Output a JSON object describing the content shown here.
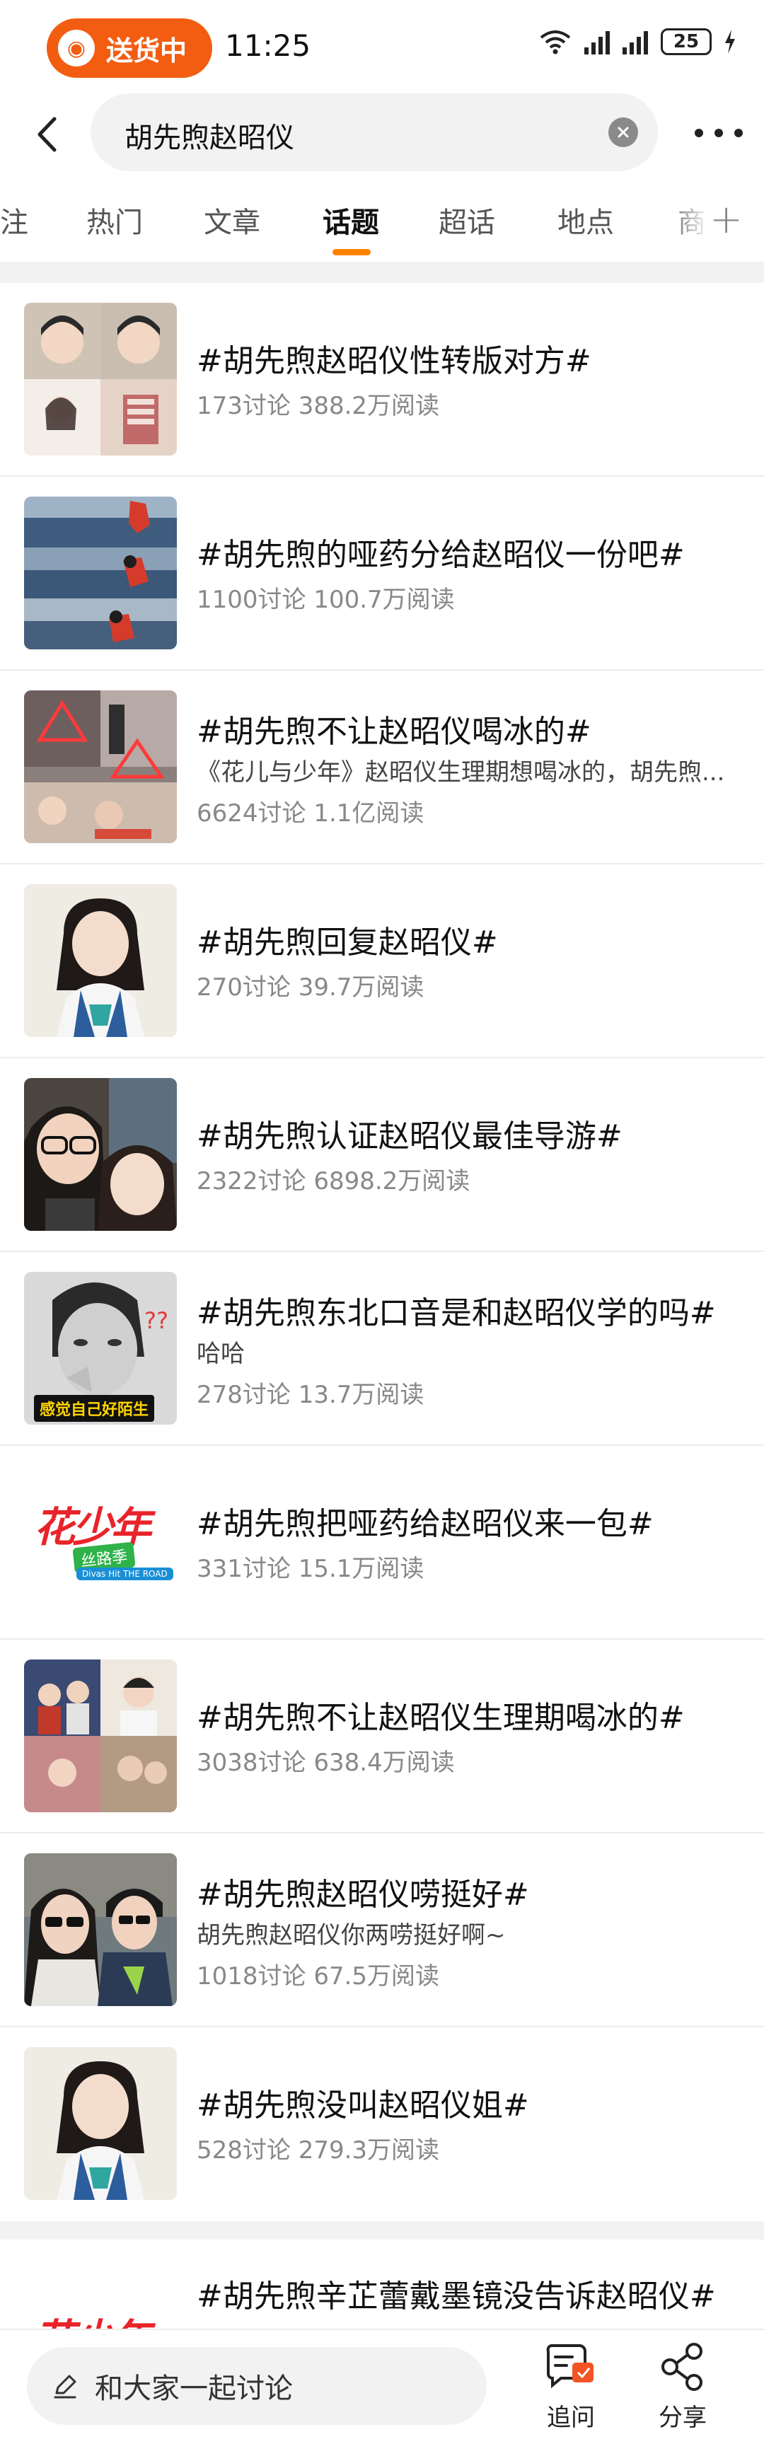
{
  "status_bar": {
    "delivery_label": "送货中",
    "time": "11:25",
    "battery": "25"
  },
  "search": {
    "query": "胡先煦赵昭仪"
  },
  "tabs": [
    {
      "label": "注"
    },
    {
      "label": "热门"
    },
    {
      "label": "文章"
    },
    {
      "label": "话题",
      "active": true
    },
    {
      "label": "超话"
    },
    {
      "label": "地点"
    },
    {
      "label": "商"
    }
  ],
  "topics": [
    {
      "title": "#胡先煦赵昭仪性转版对方#",
      "desc": "",
      "stats": "173讨论 388.2万阅读"
    },
    {
      "title": "#胡先煦的哑药分给赵昭仪一份吧#",
      "desc": "",
      "stats": "1100讨论 100.7万阅读"
    },
    {
      "title": "#胡先煦不让赵昭仪喝冰的#",
      "desc": "《花儿与少年》赵昭仪生理期想喝冰的，胡先煦...",
      "stats": "6624讨论 1.1亿阅读"
    },
    {
      "title": "#胡先煦回复赵昭仪#",
      "desc": "",
      "stats": "270讨论 39.7万阅读"
    },
    {
      "title": "#胡先煦认证赵昭仪最佳导游#",
      "desc": "",
      "stats": "2322讨论 6898.2万阅读"
    },
    {
      "title": "#胡先煦东北口音是和赵昭仪学的吗#",
      "desc": "哈哈",
      "stats": "278讨论 13.7万阅读"
    },
    {
      "title": "#胡先煦把哑药给赵昭仪来一包#",
      "desc": "",
      "stats": "331讨论 15.1万阅读"
    },
    {
      "title": "#胡先煦不让赵昭仪生理期喝冰的#",
      "desc": "",
      "stats": "3038讨论 638.4万阅读"
    },
    {
      "title": "#胡先煦赵昭仪唠挺好#",
      "desc": "胡先煦赵昭仪你两唠挺好啊~",
      "stats": "1018讨论 67.5万阅读"
    },
    {
      "title": "#胡先煦没叫赵昭仪姐#",
      "desc": "",
      "stats": "528讨论 279.3万阅读"
    },
    {
      "title": "#胡先煦辛芷蕾戴墨镜没告诉赵昭仪#",
      "desc": "",
      "stats": ""
    }
  ],
  "thumb_texts": {
    "t3_caption": "感觉自己好陌生",
    "show_logo_main": "花少年",
    "show_logo_sub": "丝路季",
    "show_logo_en": "Divas Hit THE ROAD"
  },
  "bottom_bar": {
    "comment_placeholder": "和大家一起讨论",
    "follow_label": "追问",
    "share_label": "分享"
  },
  "colors": {
    "accent": "#ff8200",
    "delivery": "#f25d12",
    "divider": "#f2f2f2"
  }
}
